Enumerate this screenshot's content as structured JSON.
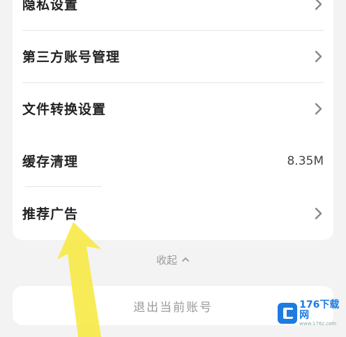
{
  "settings": {
    "rows": [
      {
        "label": "隐私设置",
        "value": "",
        "chevron": true
      },
      {
        "label": "第三方账号管理",
        "value": "",
        "chevron": true
      },
      {
        "label": "文件转换设置",
        "value": "",
        "chevron": true
      },
      {
        "label": "缓存清理",
        "value": "8.35M",
        "chevron": false
      },
      {
        "label": "推荐广告",
        "value": "",
        "chevron": true
      }
    ]
  },
  "collapse": {
    "label": "收起",
    "icon": "chevron-up-icon"
  },
  "logout": {
    "label": "退出当前账号"
  },
  "watermark": {
    "brand": "176下载网",
    "sub": "www.176z.com"
  },
  "colors": {
    "background": "#f3f3f3",
    "card": "#ffffff",
    "annotation_arrow": "#f7e94a",
    "watermark": "#1e7be0"
  }
}
